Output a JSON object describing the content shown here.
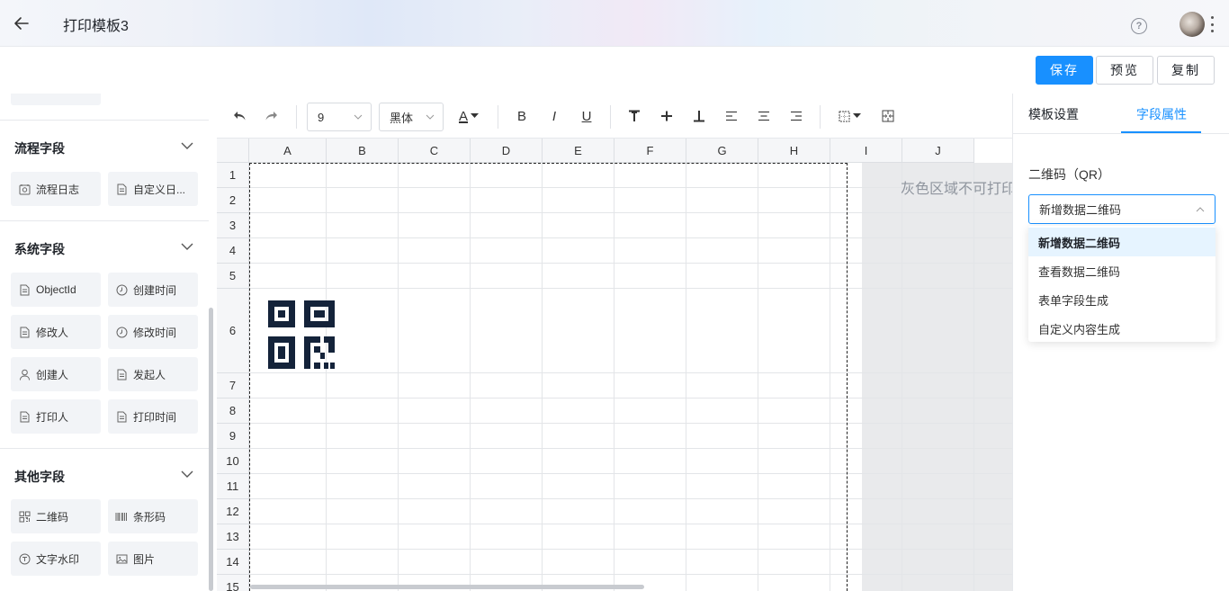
{
  "header": {
    "title": "打印模板3",
    "help_glyph": "?"
  },
  "actions": {
    "save": "保存",
    "preview": "预览",
    "copy": "复制"
  },
  "sidebar": {
    "sections": [
      {
        "title": "流程字段",
        "items": [
          {
            "label": "流程日志",
            "icon": "log-icon"
          },
          {
            "label": "自定义日...",
            "icon": "document-icon"
          }
        ]
      },
      {
        "title": "系统字段",
        "items": [
          {
            "label": "ObjectId",
            "icon": "document-icon"
          },
          {
            "label": "创建时间",
            "icon": "clock-icon"
          },
          {
            "label": "修改人",
            "icon": "document-icon"
          },
          {
            "label": "修改时间",
            "icon": "clock-icon"
          },
          {
            "label": "创建人",
            "icon": "user-icon"
          },
          {
            "label": "发起人",
            "icon": "document-icon"
          },
          {
            "label": "打印人",
            "icon": "document-icon"
          },
          {
            "label": "打印时间",
            "icon": "document-icon"
          }
        ]
      },
      {
        "title": "其他字段",
        "items": [
          {
            "label": "二维码",
            "icon": "qrcode-icon"
          },
          {
            "label": "条形码",
            "icon": "barcode-icon"
          },
          {
            "label": "文字水印",
            "icon": "watermark-icon"
          },
          {
            "label": "图片",
            "icon": "image-icon"
          }
        ]
      }
    ]
  },
  "toolbar": {
    "font_size": "9",
    "font_family": "黑体",
    "font_color_glyph": "A",
    "bold": "B",
    "italic": "I",
    "underline": "U"
  },
  "sheet": {
    "columns": [
      "A",
      "B",
      "C",
      "D",
      "E",
      "F",
      "G",
      "H",
      "I",
      "J"
    ],
    "rows": [
      "1",
      "2",
      "3",
      "4",
      "5",
      "6",
      "7",
      "8",
      "9",
      "10",
      "11",
      "12",
      "13",
      "14",
      "15"
    ],
    "gray_area_text": "灰色区域不可打印"
  },
  "panel": {
    "tabs": [
      "模板设置",
      "字段属性"
    ],
    "active_tab": 1,
    "field_label": "二维码（QR）",
    "select_value": "新增数据二维码",
    "options": [
      "新增数据二维码",
      "查看数据二维码",
      "表单字段生成",
      "自定义内容生成"
    ]
  },
  "colors": {
    "accent": "#1890ff",
    "nonprint_area": "#e9eaec"
  }
}
